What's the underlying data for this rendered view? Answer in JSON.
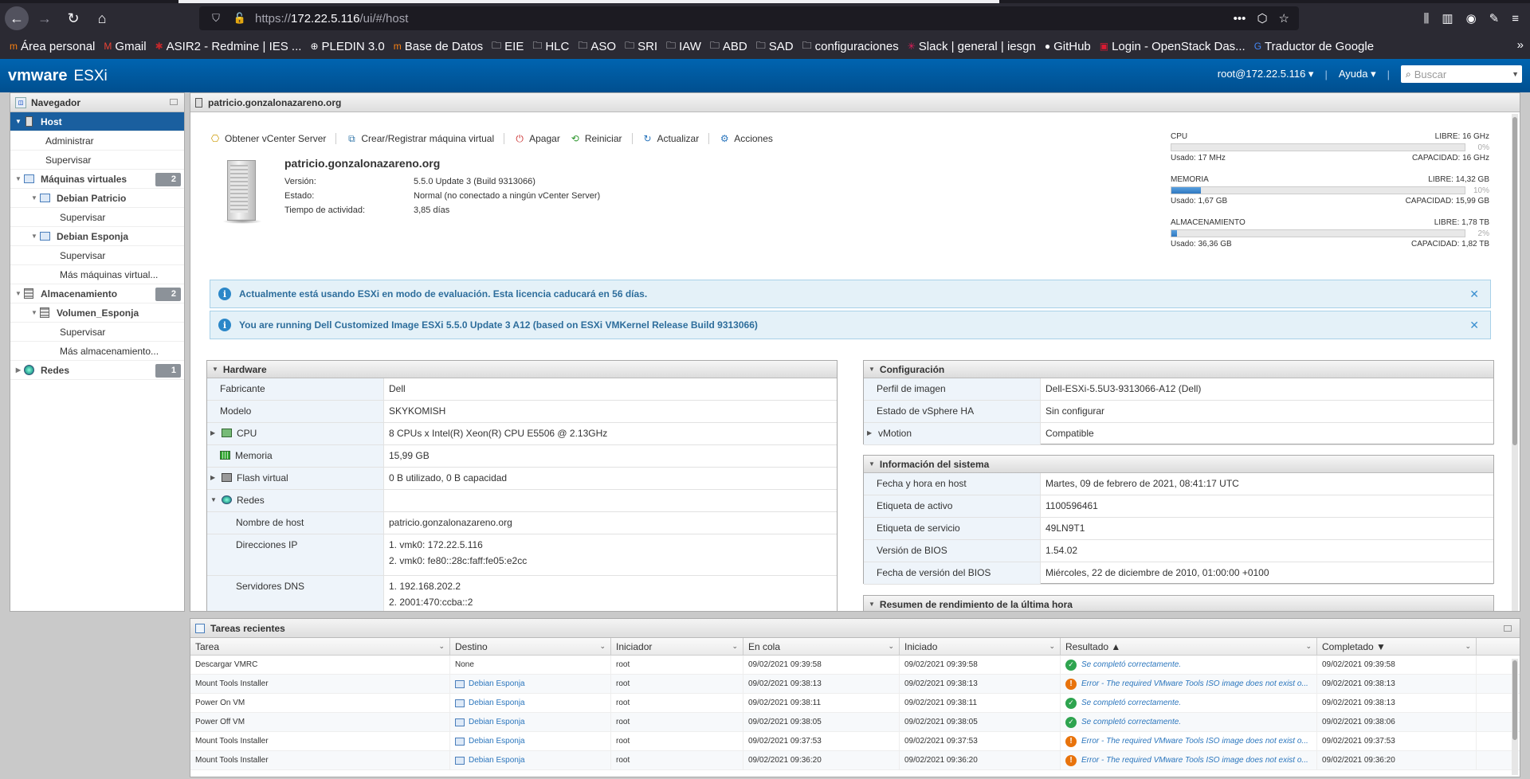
{
  "browser": {
    "url_prefix": "https://",
    "url_host": "172.22.5.116",
    "url_path": "/ui/#/host",
    "menu_dots": "•••"
  },
  "bookmarks": [
    {
      "label": "Área personal",
      "icon": "moodle-icon"
    },
    {
      "label": "Gmail",
      "icon": "gmail-icon"
    },
    {
      "label": "ASIR2 - Redmine | IES ...",
      "icon": "redmine-icon"
    },
    {
      "label": "PLEDIN 3.0",
      "icon": "globe-icon"
    },
    {
      "label": "Base de Datos",
      "icon": "moodle-icon"
    },
    {
      "label": "EIE",
      "icon": "folder-icon"
    },
    {
      "label": "HLC",
      "icon": "folder-icon"
    },
    {
      "label": "ASO",
      "icon": "folder-icon"
    },
    {
      "label": "SRI",
      "icon": "folder-icon"
    },
    {
      "label": "IAW",
      "icon": "folder-icon"
    },
    {
      "label": "ABD",
      "icon": "folder-icon"
    },
    {
      "label": "SAD",
      "icon": "folder-icon"
    },
    {
      "label": "configuraciones",
      "icon": "folder-icon"
    },
    {
      "label": "Slack | general | iesgn",
      "icon": "slack-icon"
    },
    {
      "label": "GitHub",
      "icon": "github-icon"
    },
    {
      "label": "Login - OpenStack Das...",
      "icon": "openstack-icon"
    },
    {
      "label": "Traductor de Google",
      "icon": "translate-icon"
    }
  ],
  "header": {
    "brand_vm": "vmware",
    "brand_product": "ESXi",
    "user": "root@172.22.5.116 ▾",
    "help": "Ayuda ▾",
    "search_placeholder": "Buscar"
  },
  "navigator": {
    "title": "Navegador",
    "items": [
      {
        "label": "Host",
        "level": 0,
        "active": true
      },
      {
        "label": "Administrar",
        "level": 2
      },
      {
        "label": "Supervisar",
        "level": 2
      },
      {
        "label": "Máquinas virtuales",
        "level": 0,
        "badge": "2"
      },
      {
        "label": "Debian Patricio",
        "level": 1
      },
      {
        "label": "Supervisar",
        "level": 3
      },
      {
        "label": "Debian Esponja",
        "level": 1
      },
      {
        "label": "Supervisar",
        "level": 3
      },
      {
        "label": "Más máquinas virtual...",
        "level": 3
      },
      {
        "label": "Almacenamiento",
        "level": 0,
        "badge": "2"
      },
      {
        "label": "Volumen_Esponja",
        "level": 1
      },
      {
        "label": "Supervisar",
        "level": 3
      },
      {
        "label": "Más almacenamiento...",
        "level": 3
      },
      {
        "label": "Redes",
        "level": 0,
        "badge": "1"
      }
    ]
  },
  "main": {
    "title": "patricio.gonzalonazareno.org",
    "toolbar": {
      "vcenter": "Obtener vCenter Server",
      "create_vm": "Crear/Registrar máquina virtual",
      "shutdown": "Apagar",
      "reboot": "Reiniciar",
      "refresh": "Actualizar",
      "actions": "Acciones"
    },
    "host_name": "patricio.gonzalonazareno.org",
    "host_props": [
      {
        "k": "Versión:",
        "v": "5.5.0 Update 3 (Build 9313066)"
      },
      {
        "k": "Estado:",
        "v": "Normal (no conectado a ningún vCenter Server)"
      },
      {
        "k": "Tiempo de actividad:",
        "v": "3,85 días"
      }
    ],
    "resources": [
      {
        "name": "CPU",
        "free": "LIBRE: 16 GHz",
        "pct": "0%",
        "pct_value": 0,
        "used": "Usado: 17 MHz",
        "cap": "CAPACIDAD: 16 GHz"
      },
      {
        "name": "MEMORIA",
        "free": "LIBRE: 14,32 GB",
        "pct": "10%",
        "pct_value": 10,
        "used": "Usado: 1,67 GB",
        "cap": "CAPACIDAD: 15,99 GB"
      },
      {
        "name": "ALMACENAMIENTO",
        "free": "LIBRE: 1,78 TB",
        "pct": "2%",
        "pct_value": 2,
        "used": "Usado: 36,36 GB",
        "cap": "CAPACIDAD: 1,82 TB"
      }
    ],
    "notices": [
      "Actualmente está usando ESXi en modo de evaluación. Esta licencia caducará en 56 días.",
      "You are running Dell Customized Image ESXi 5.5.0 Update 3 A12 (based on ESXi VMKernel Release Build 9313066)"
    ],
    "hardware": {
      "title": "Hardware",
      "fabricante_k": "Fabricante",
      "fabricante_v": "Dell",
      "modelo_k": "Modelo",
      "modelo_v": "SKYKOMISH",
      "cpu_k": "CPU",
      "cpu_v": "8 CPUs x Intel(R) Xeon(R) CPU E5506 @ 2.13GHz",
      "memoria_k": "Memoria",
      "memoria_v": "15,99 GB",
      "flash_k": "Flash virtual",
      "flash_v": "0 B utilizado, 0 B capacidad",
      "redes_k": "Redes",
      "hostname_k": "Nombre de host",
      "hostname_v": "patricio.gonzalonazareno.org",
      "ip_k": "Direcciones IP",
      "ip_v1": "1. vmk0: 172.22.5.116",
      "ip_v2": "2. vmk0: fe80::28c:faff:fe05:e2cc",
      "dns_k": "Servidores DNS",
      "dns_v1": "1. 192.168.202.2",
      "dns_v2": "2. 2001:470:ccba::2"
    },
    "config": {
      "title": "Configuración",
      "perfil_k": "Perfil de imagen",
      "perfil_v": "Dell-ESXi-5.5U3-9313066-A12 (Dell)",
      "ha_k": "Estado de vSphere HA",
      "ha_v": "Sin configurar",
      "vmotion_k": "vMotion",
      "vmotion_v": "Compatible"
    },
    "sysinfo": {
      "title": "Información del sistema",
      "fecha_k": "Fecha y hora en host",
      "fecha_v": "Martes, 09 de febrero de 2021, 08:41:17 UTC",
      "activo_k": "Etiqueta de activo",
      "activo_v": "1100596461",
      "servicio_k": "Etiqueta de servicio",
      "servicio_v": "49LN9T1",
      "bios_k": "Versión de BIOS",
      "bios_v": "1.54.02",
      "biosfecha_k": "Fecha de versión del BIOS",
      "biosfecha_v": "Miércoles, 22 de diciembre de 2010, 01:00:00 +0100"
    },
    "perf_title": "Resumen de rendimiento de la última hora"
  },
  "tasks": {
    "title": "Tareas recientes",
    "columns": [
      "Tarea",
      "Destino",
      "Iniciador",
      "En cola",
      "Iniciado",
      "Resultado ▲",
      "Completado ▼"
    ],
    "rows": [
      {
        "task": "Descargar VMRC",
        "target": "None",
        "target_link": false,
        "init": "root",
        "queued": "09/02/2021 09:39:58",
        "started": "09/02/2021 09:39:58",
        "status": "ok",
        "result": "Se completó correctamente.",
        "done": "09/02/2021 09:39:58"
      },
      {
        "task": "Mount Tools Installer",
        "target": "Debian Esponja",
        "target_link": true,
        "init": "root",
        "queued": "09/02/2021 09:38:13",
        "started": "09/02/2021 09:38:13",
        "status": "error",
        "result": "Error - The required VMware Tools ISO image does not exist o...",
        "done": "09/02/2021 09:38:13"
      },
      {
        "task": "Power On VM",
        "target": "Debian Esponja",
        "target_link": true,
        "init": "root",
        "queued": "09/02/2021 09:38:11",
        "started": "09/02/2021 09:38:11",
        "status": "ok",
        "result": "Se completó correctamente.",
        "done": "09/02/2021 09:38:13"
      },
      {
        "task": "Power Off VM",
        "target": "Debian Esponja",
        "target_link": true,
        "init": "root",
        "queued": "09/02/2021 09:38:05",
        "started": "09/02/2021 09:38:05",
        "status": "ok",
        "result": "Se completó correctamente.",
        "done": "09/02/2021 09:38:06"
      },
      {
        "task": "Mount Tools Installer",
        "target": "Debian Esponja",
        "target_link": true,
        "init": "root",
        "queued": "09/02/2021 09:37:53",
        "started": "09/02/2021 09:37:53",
        "status": "error",
        "result": "Error - The required VMware Tools ISO image does not exist o...",
        "done": "09/02/2021 09:37:53"
      },
      {
        "task": "Mount Tools Installer",
        "target": "Debian Esponja",
        "target_link": true,
        "init": "root",
        "queued": "09/02/2021 09:36:20",
        "started": "09/02/2021 09:36:20",
        "status": "error",
        "result": "Error - The required VMware Tools ISO image does not exist o...",
        "done": "09/02/2021 09:36:20"
      }
    ]
  }
}
